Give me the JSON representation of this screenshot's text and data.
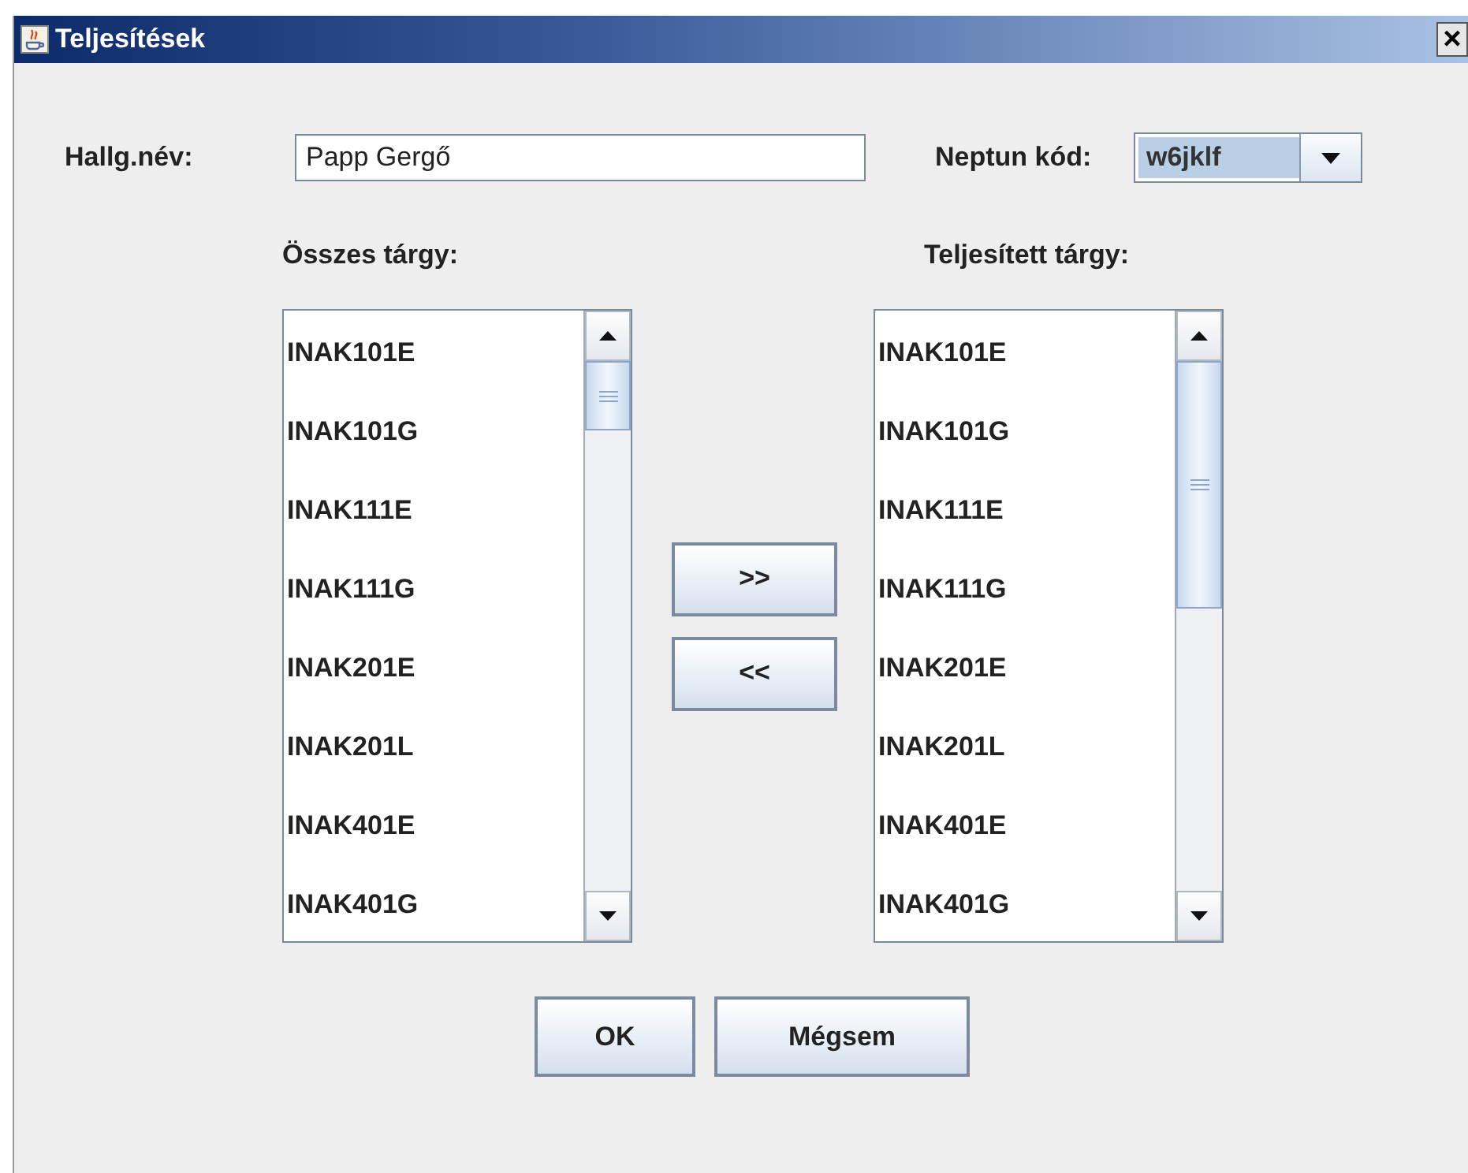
{
  "window": {
    "title": "Teljesítések",
    "close": "×"
  },
  "student_name": {
    "label": "Hallg.név:",
    "value": "Papp Gergő"
  },
  "neptun_code": {
    "label": "Neptun kód:",
    "value": "w6jklf"
  },
  "all_subjects": {
    "heading": "Összes tárgy:",
    "items": [
      "INAK101E",
      "INAK101G",
      "INAK111E",
      "INAK111G",
      "INAK201E",
      "INAK201L",
      "INAK401E",
      "INAK401G"
    ]
  },
  "move_buttons": [
    ">>",
    "<<"
  ],
  "completed_subjects": {
    "heading": "Teljesített tárgy:",
    "items": [
      "INAK101E",
      "INAK101G",
      "INAK111E",
      "INAK111G",
      "INAK201E",
      "INAK201L",
      "INAK401E",
      "INAK401G"
    ]
  },
  "buttons": [
    "OK",
    "Mégsem"
  ]
}
